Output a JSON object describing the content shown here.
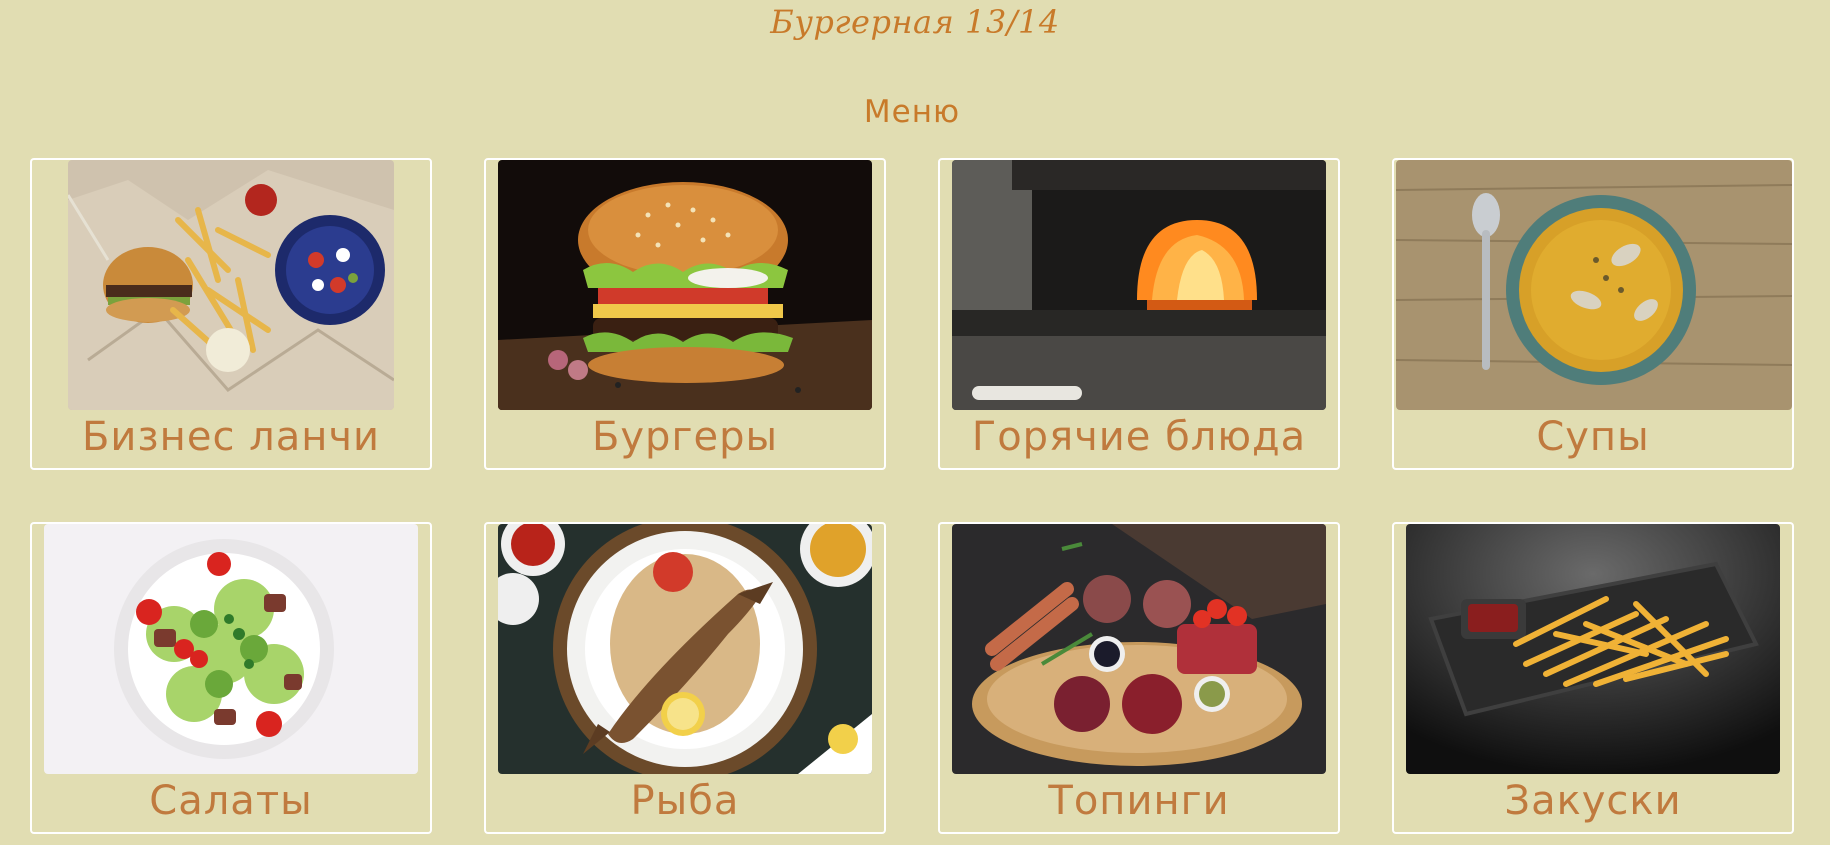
{
  "header": {
    "site_title": "Бургерная 13/14",
    "menu_heading": "Меню"
  },
  "categories": [
    {
      "label": "Бизнес ланчи",
      "image": "business-lunch-photo"
    },
    {
      "label": "Бургеры",
      "image": "burger-photo"
    },
    {
      "label": "Горячие блюда",
      "image": "hot-dishes-oven-photo"
    },
    {
      "label": "Супы",
      "image": "soup-photo"
    },
    {
      "label": "Салаты",
      "image": "salad-photo"
    },
    {
      "label": "Рыба",
      "image": "fish-photo"
    },
    {
      "label": "Топинги",
      "image": "toppings-meat-photo"
    },
    {
      "label": "Закуски",
      "image": "snacks-fries-photo"
    }
  ],
  "colors": {
    "background": "#e1ddb2",
    "title": "#c87a2a",
    "card_label": "#c07a3e",
    "card_border": "#ffffff"
  }
}
